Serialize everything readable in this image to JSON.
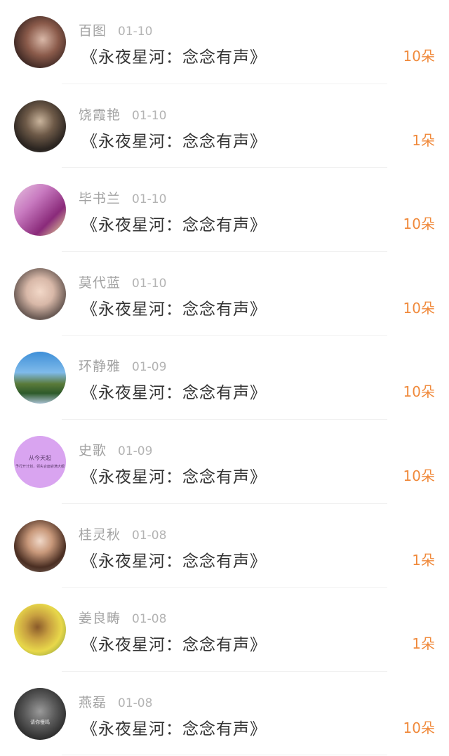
{
  "items": [
    {
      "name": "百图",
      "date": "01-10",
      "title": "《永夜星河：念念有声》",
      "count": "10朵"
    },
    {
      "name": "饶霞艳",
      "date": "01-10",
      "title": "《永夜星河：念念有声》",
      "count": "1朵"
    },
    {
      "name": "毕书兰",
      "date": "01-10",
      "title": "《永夜星河：念念有声》",
      "count": "10朵"
    },
    {
      "name": "莫代蓝",
      "date": "01-10",
      "title": "《永夜星河：念念有声》",
      "count": "10朵"
    },
    {
      "name": "环静雅",
      "date": "01-09",
      "title": "《永夜星河：念念有声》",
      "count": "10朵"
    },
    {
      "name": "史歌",
      "date": "01-09",
      "title": "《永夜星河：念念有声》",
      "count": "10朵",
      "avatar_text": [
        "从今天起",
        "予行开计划，领失合面容满大眼"
      ]
    },
    {
      "name": "桂灵秋",
      "date": "01-08",
      "title": "《永夜星河：念念有声》",
      "count": "1朵"
    },
    {
      "name": "姜良畴",
      "date": "01-08",
      "title": "《永夜星河：念念有声》",
      "count": "1朵"
    },
    {
      "name": "燕磊",
      "date": "01-08",
      "title": "《永夜星河：念念有声》",
      "count": "10朵",
      "avatar_text": [
        "请你慢鸣"
      ]
    }
  ],
  "colors": {
    "count": "#f08a3c",
    "name": "#a3a3a3",
    "title": "#333333"
  }
}
